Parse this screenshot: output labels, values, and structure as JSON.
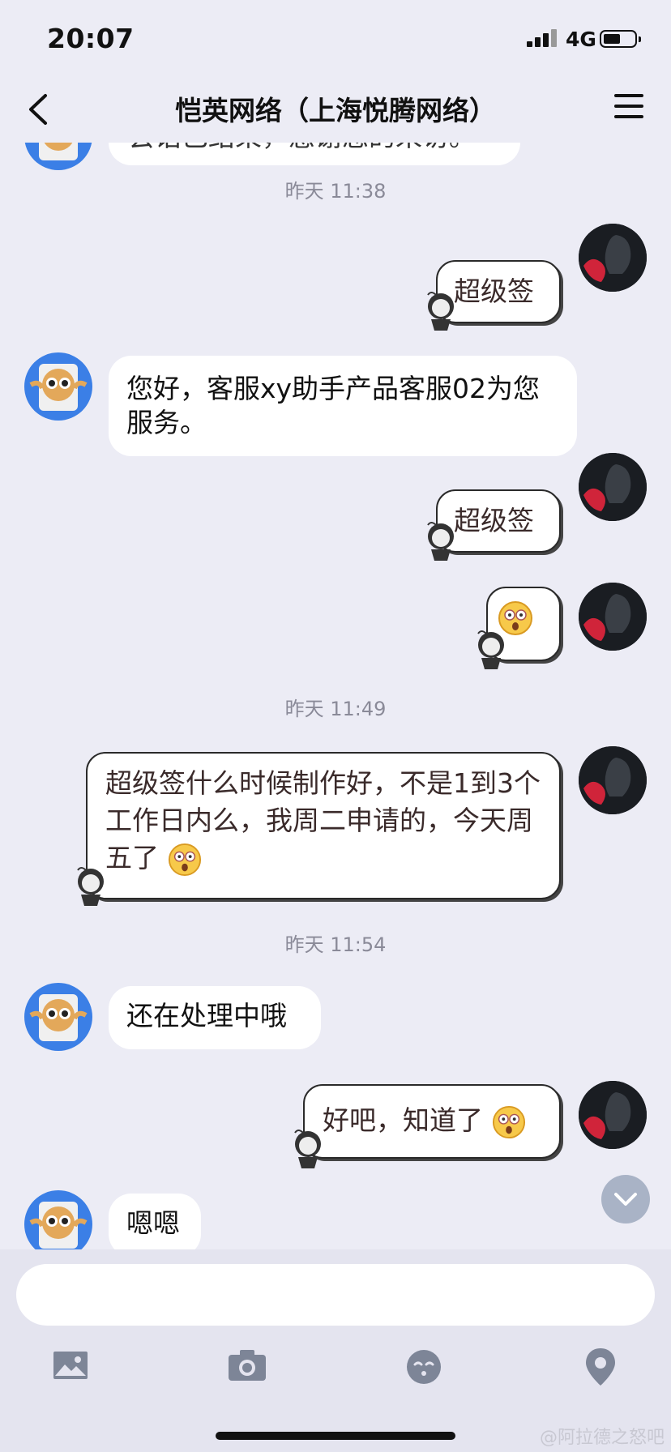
{
  "status": {
    "time": "20:07",
    "network": "4G"
  },
  "nav": {
    "title": "恺英网络（上海悦腾网络）"
  },
  "messages": {
    "partial_top": "会话已结束，感谢您的来访。",
    "ts1": "昨天 11:38",
    "m1": "超级签",
    "m2": "您好，客服xy助手产品客服02为您服务。",
    "m3": "超级签",
    "ts2": "昨天 11:49",
    "m5": "超级签什么时候制作好，不是1到3个工作日内么，我周二申请的，今天周五了",
    "ts3": "昨天 11:54",
    "m6": "还在处理中哦",
    "m7": "好吧，知道了",
    "m8": "嗯嗯"
  },
  "watermark": "@阿拉德之怒吧",
  "icons": [
    "back-icon",
    "menu-icon",
    "bot-avatar-icon",
    "user-avatar-icon",
    "astonished-emoji-icon",
    "image-icon",
    "camera-icon",
    "emoji-icon",
    "location-icon",
    "chevron-down-icon"
  ]
}
